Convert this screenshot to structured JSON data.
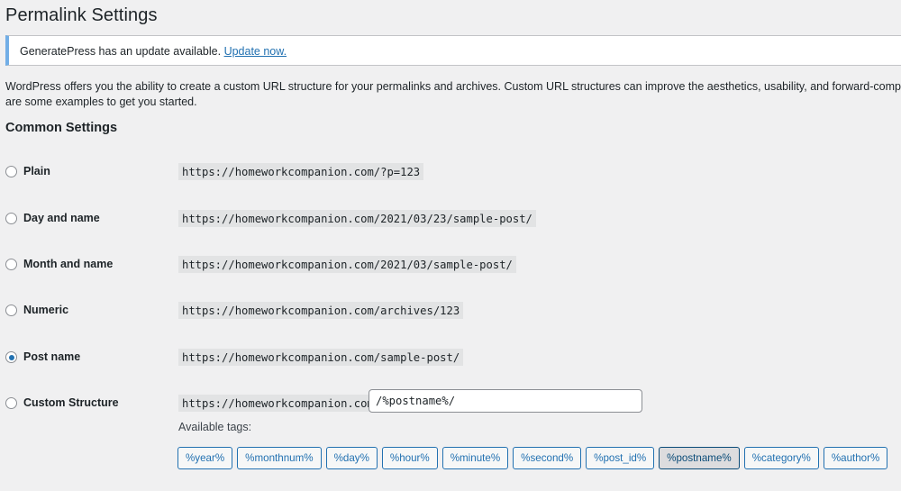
{
  "page": {
    "title": "Permalink Settings"
  },
  "notice": {
    "text": "GeneratePress has an update available.",
    "link_label": "Update now."
  },
  "intro": {
    "line1": "WordPress offers you the ability to create a custom URL structure for your permalinks and archives. Custom URL structures can improve the aesthetics, usability, and forward-compatibility o",
    "line2": "are some examples to get you started."
  },
  "common_settings": {
    "title": "Common Settings",
    "options": [
      {
        "label": "Plain",
        "example": "https://homeworkcompanion.com/?p=123",
        "selected": false
      },
      {
        "label": "Day and name",
        "example": "https://homeworkcompanion.com/2021/03/23/sample-post/",
        "selected": false
      },
      {
        "label": "Month and name",
        "example": "https://homeworkcompanion.com/2021/03/sample-post/",
        "selected": false
      },
      {
        "label": "Numeric",
        "example": "https://homeworkcompanion.com/archives/123",
        "selected": false
      },
      {
        "label": "Post name",
        "example": "https://homeworkcompanion.com/sample-post/",
        "selected": true
      },
      {
        "label": "Custom Structure",
        "example": "https://homeworkcompanion.com",
        "selected": false
      }
    ],
    "custom_structure_value": "/%postname%/",
    "available_tags_label": "Available tags:",
    "tags": [
      "%year%",
      "%monthnum%",
      "%day%",
      "%hour%",
      "%minute%",
      "%second%",
      "%post_id%",
      "%postname%",
      "%category%",
      "%author%"
    ],
    "active_tag": "%postname%"
  },
  "colors": {
    "background": "#f0f0f1",
    "accent": "#2271b1",
    "notice_border": "#72aee6"
  }
}
